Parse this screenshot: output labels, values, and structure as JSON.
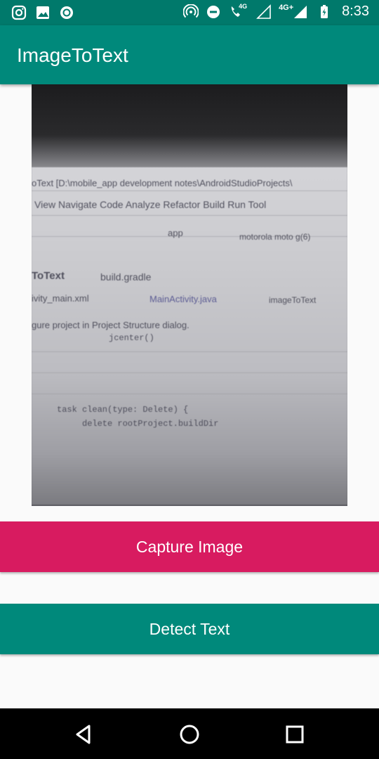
{
  "status_bar": {
    "time": "8:33",
    "network_label": "4G",
    "network_label_2": "4G+",
    "icons": [
      "instagram-icon",
      "gallery-icon",
      "circle-icon",
      "hotspot-icon",
      "do-not-disturb-icon",
      "wifi-call-icon",
      "signal-icon",
      "battery-icon"
    ]
  },
  "app_bar": {
    "title": "ImageToText"
  },
  "photo": {
    "text_lines": [
      "oText [D:\\mobile_app development notes\\AndroidStudioProjects\\",
      "View  Navigate  Code  Analyze  Refactor  Build  Run  Tool",
      "app",
      "motorola moto g(6)",
      "ToText",
      "build.gradle",
      "ivity_main.xml",
      "MainActivity.java",
      "imageToText",
      "gure project in Project Structure dialog.",
      "jcenter()",
      "task clean(type: Delete) {",
      "delete rootProject.buildDir"
    ]
  },
  "buttons": {
    "capture_label": "Capture Image",
    "detect_label": "Detect Text"
  },
  "colors": {
    "status_bar": "#00796b",
    "app_bar": "#00897b",
    "capture_button": "#d81b60",
    "detect_button": "#00897b",
    "background": "#fafafa"
  },
  "nav_bar": {
    "icons": [
      "back-icon",
      "home-icon",
      "recents-icon"
    ]
  }
}
